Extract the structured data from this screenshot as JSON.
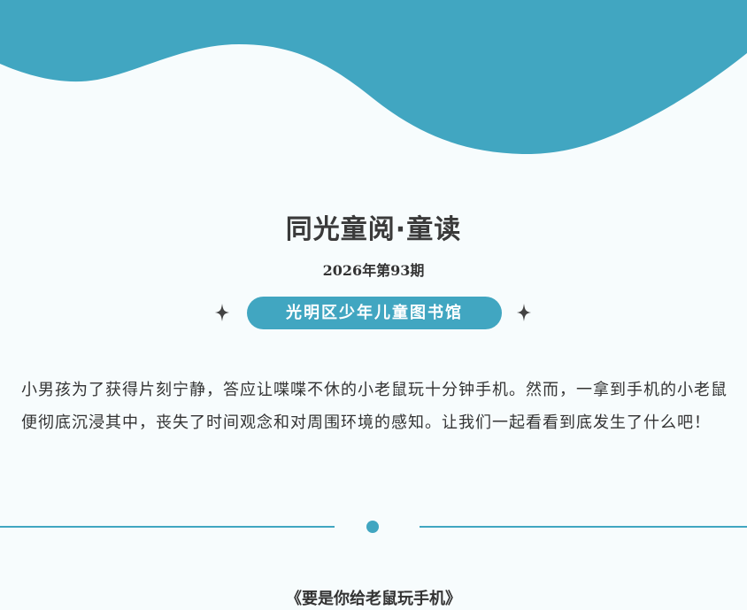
{
  "header": {
    "title": "同光童阅·童读",
    "issue": "2026年第93期",
    "library_badge": "光明区少年儿童图书馆"
  },
  "intro_text": "小男孩为了获得片刻宁静，答应让喋喋不休的小老鼠玩十分钟手机。然而，一拿到手机的小老鼠便彻底沉浸其中，丧失了时间观念和对周围环境的感知。让我们一起看看到底发生了什么吧！",
  "book_title": "《要是你给老鼠玩手机》",
  "colors": {
    "accent": "#41a6c1",
    "background": "#f7fcfd",
    "text": "#333333"
  },
  "icons": {
    "left_decoration": "sparkle-icon",
    "right_decoration": "sparkle-icon",
    "divider_center": "dot-icon"
  }
}
